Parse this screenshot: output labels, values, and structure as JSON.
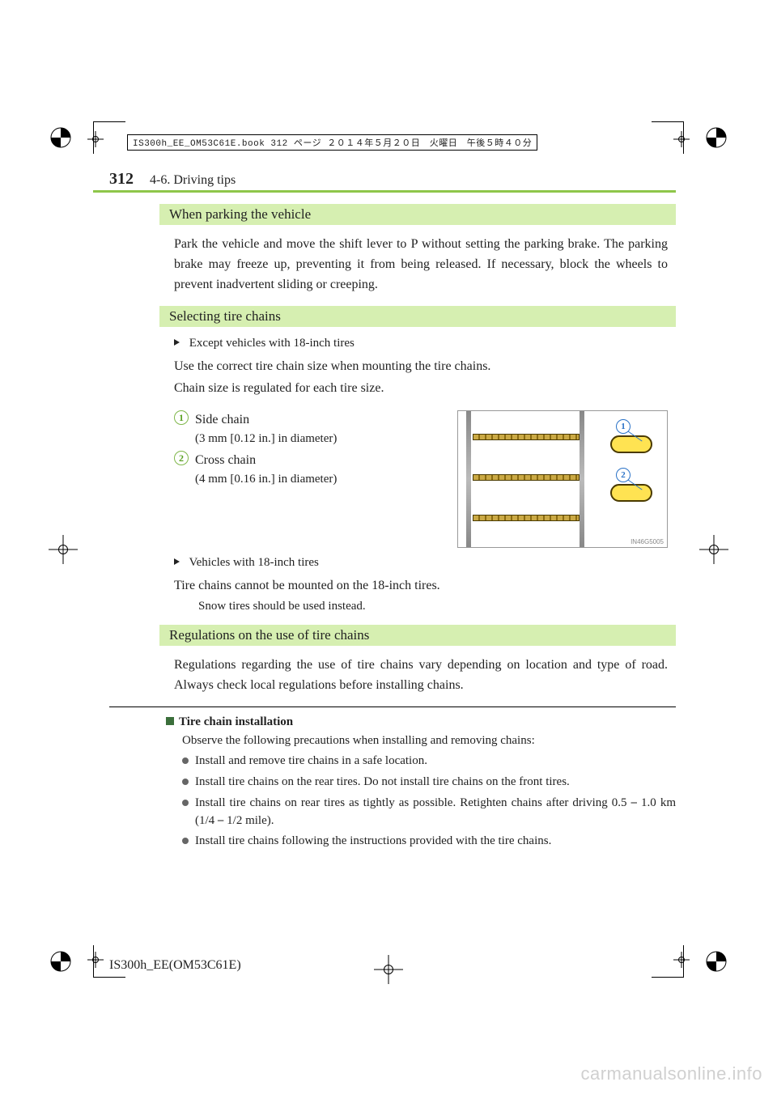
{
  "print_header": "IS300h_EE_OM53C61E.book  312 ページ  ２０１４年５月２０日　火曜日　午後５時４０分",
  "page_number": "312",
  "section_label": "4-6. Driving tips",
  "sections": {
    "parking": {
      "heading": "When parking the vehicle",
      "body": "Park the vehicle and move the shift lever to P without setting the parking brake. The parking brake may freeze up, preventing it from being released. If necessary, block the wheels to prevent inadvertent sliding or creeping."
    },
    "chains": {
      "heading": "Selecting tire chains",
      "sub1_label": "Except vehicles with 18-inch tires",
      "sub1_p1": "Use the correct tire chain size when mounting the tire chains.",
      "sub1_p2": "Chain size is regulated for each tire size.",
      "items": [
        {
          "num": "1",
          "title": "Side chain",
          "detail": "(3 mm [0.12 in.] in diameter)"
        },
        {
          "num": "2",
          "title": "Cross chain",
          "detail": "(4 mm [0.16 in.] in diameter)"
        }
      ],
      "fig_id": "IN46G5005",
      "sub2_label": "Vehicles with 18-inch tires",
      "sub2_p1": "Tire chains cannot be mounted on the 18-inch tires.",
      "sub2_p2": "Snow tires should be used instead."
    },
    "regs": {
      "heading": "Regulations on the use of tire chains",
      "body": "Regulations regarding the use of tire chains vary depending on location and type of road. Always check local regulations before installing chains."
    },
    "install": {
      "heading": "Tire chain installation",
      "intro": "Observe the following precautions when installing and removing chains:",
      "bullets": [
        "Install and remove tire chains in a safe location.",
        "Install tire chains on the rear tires. Do not install tire chains on the front tires.",
        "Install tire chains on rear tires as tightly as possible. Retighten chains after driving 0.5 ⎯ 1.0 km (1/4 ⎯ 1/2 mile).",
        "Install tire chains following the instructions provided with the tire chains."
      ]
    }
  },
  "footer_model": "IS300h_EE(OM53C61E)",
  "watermark": "carmanualsonline.info"
}
